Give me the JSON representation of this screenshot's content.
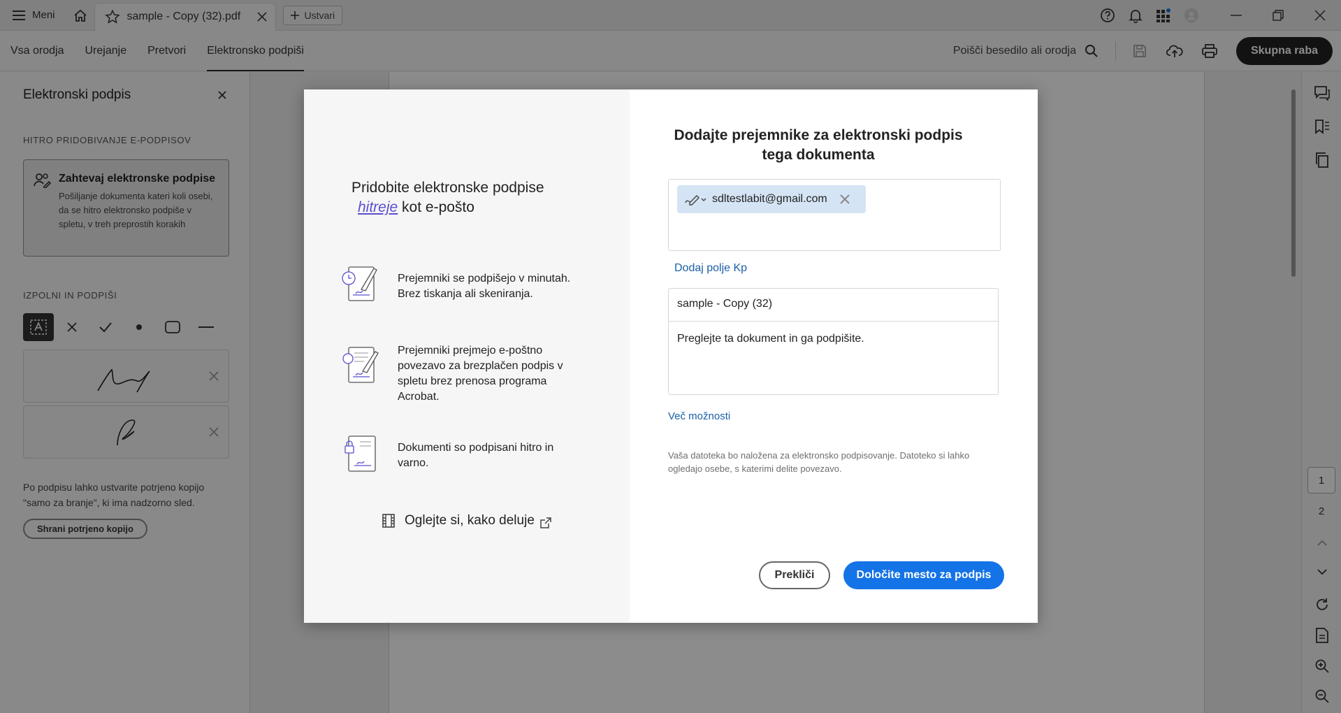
{
  "titlebar": {
    "menu_label": "Meni",
    "tab_title": "sample - Copy (32).pdf",
    "create_label": "Ustvari"
  },
  "toolbar": {
    "nav": [
      "Vsa orodja",
      "Urejanje",
      "Pretvori",
      "Elektronsko podpiši"
    ],
    "active_nav": "Elektronsko podpiši",
    "find_label": "Poišči besedilo ali orodja",
    "share_label": "Skupna raba"
  },
  "leftpanel": {
    "title": "Elektronski podpis",
    "section1": "HITRO PRIDOBIVANJE E-PODPISOV",
    "card_title": "Zahtevaj elektronske podpise",
    "card_desc": "Pošiljanje dokumenta kateri koli osebi, da se hitro elektronsko podpiše v spletu, v treh preprostih korakih",
    "section2": "IZPOLNI IN PODPIŠI",
    "note": "Po podpisu lahko ustvarite potrjeno kopijo \"samo za branje\", ki ima nadzorno sled.",
    "save_copy_label": "Shrani potrjeno kopijo"
  },
  "pages": [
    "1",
    "2"
  ],
  "modal": {
    "left": {
      "heading_line1": "Pridobite elektronske podpise",
      "heading_emph": "hitreje",
      "heading_rest": "kot e-pošto",
      "features": [
        "Prejemniki se podpišejo v minutah. Brez tiskanja ali skeniranja.",
        "Prejemniki prejmejo e-poštno povezavo za brezplačen podpis v spletu brez prenosa programa Acrobat.",
        "Dokumenti so podpisani hitro in varno."
      ],
      "howto_label": "Oglejte si, kako deluje"
    },
    "right": {
      "heading": "Dodajte prejemnike za elektronski podpis tega dokumenta",
      "recipient_email": "sdltestlabit@gmail.com",
      "add_cc_label": "Dodaj polje Kp",
      "subject_value": "sample - Copy (32)",
      "message_value": "Preglejte ta dokument in ga podpišite.",
      "more_options_label": "Več možnosti",
      "upload_note": "Vaša datoteka bo naložena za elektronsko podpisovanje. Datoteko si lahko ogledajo osebe, s katerimi delite povezavo.",
      "cancel_label": "Prekliči",
      "primary_label": "Določite mesto za podpis"
    }
  },
  "colors": {
    "primary_button": "#1473e6",
    "link": "#1a5fa8",
    "chip": "#d4e4f4",
    "emphasis": "#5a4fcf"
  }
}
